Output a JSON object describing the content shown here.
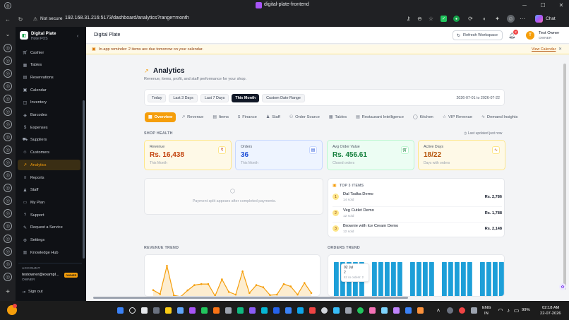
{
  "browser": {
    "tab_title": "digital-plate-frontend",
    "security": "Not secure",
    "url": "192.168.31.216:5173/dashboard/analytics?range=month",
    "chat_label": "Chat"
  },
  "sidebar": {
    "brand_name": "Digital Plate",
    "brand_sub": "Hotel POS",
    "items": [
      {
        "label": "Cashier",
        "icon": "cart-icon"
      },
      {
        "label": "Tables",
        "icon": "table-icon"
      },
      {
        "label": "Reservations",
        "icon": "clipboard-icon"
      },
      {
        "label": "Calendar",
        "icon": "calendar-icon"
      },
      {
        "label": "Inventory",
        "icon": "box-icon"
      },
      {
        "label": "Barcodes",
        "icon": "tag-icon"
      },
      {
        "label": "Expenses",
        "icon": "wallet-icon"
      },
      {
        "label": "Suppliers",
        "icon": "truck-icon"
      },
      {
        "label": "Customers",
        "icon": "user-icon"
      },
      {
        "label": "Analytics",
        "icon": "chart-icon"
      },
      {
        "label": "Reports",
        "icon": "report-icon"
      },
      {
        "label": "Staff",
        "icon": "users-icon"
      },
      {
        "label": "My Plan",
        "icon": "card-icon"
      },
      {
        "label": "Support",
        "icon": "help-icon"
      },
      {
        "label": "Request a Service",
        "icon": "request-icon"
      },
      {
        "label": "Settings",
        "icon": "gear-icon"
      },
      {
        "label": "Knowledge Hub",
        "icon": "book-icon"
      }
    ],
    "account_heading": "ACCOUNT",
    "account_email": "testowner@exampl...",
    "account_badge": "OWNER",
    "account_role": "OWNER",
    "sign_out": "Sign out"
  },
  "topbar": {
    "title": "Digital Plate",
    "refresh_label": "Refresh Workspace",
    "notif_count": "2",
    "avatar_letter": "T",
    "user_name": "Test Owner",
    "user_role": "OWNER"
  },
  "reminder": {
    "text": "In-app reminder: 2 items are due tomorrow on your calendar.",
    "link": "View Calendar"
  },
  "page": {
    "title": "Analytics",
    "subtitle": "Revenue, items, profit, and staff performance for your shop."
  },
  "ranges": {
    "chips": [
      "Today",
      "Last 3 Days",
      "Last 7 Days",
      "This Month",
      "Custom Date Range"
    ],
    "active": "This Month",
    "date_span": "2026-07-01 to 2026-07-22"
  },
  "tabs": [
    "Overview",
    "Revenue",
    "Items",
    "Finance",
    "Staff",
    "Order Source",
    "Tables",
    "Restaurant Intelligence",
    "Kitchen",
    "VIP Revenue",
    "Demand Insights"
  ],
  "health": {
    "heading": "SHOP HEALTH",
    "updated": "Last updated just now",
    "cards": [
      {
        "label": "Revenue",
        "value": "Rs. 16,438",
        "sub": "This Month",
        "icon": "rupee-icon",
        "accent": "#c2410c",
        "bg": "#fef9e7",
        "border": "#fde68a"
      },
      {
        "label": "Orders",
        "value": "36",
        "sub": "This Month",
        "icon": "receipt-icon",
        "accent": "#1d4ed8",
        "bg": "#eef4ff",
        "border": "#c7d7fe"
      },
      {
        "label": "Avg Order Value",
        "value": "Rs. 456.61",
        "sub": "Closed orders",
        "icon": "cart-icon",
        "accent": "#15803d",
        "bg": "#ecfdf3",
        "border": "#bbf7d0"
      },
      {
        "label": "Active Days",
        "value": "18/22",
        "sub": "Days with orders",
        "icon": "pulse-icon",
        "accent": "#b45309",
        "bg": "#fef9e7",
        "border": "#fde68a"
      }
    ]
  },
  "payment_split_msg": "Payment split appears after completed payments.",
  "top_items": {
    "heading": "TOP 3 ITEMS",
    "items": [
      {
        "rank": "1",
        "name": "Dal Tadka Demo",
        "sold": "14 sold",
        "amount": "Rs. 2,786"
      },
      {
        "rank": "2",
        "name": "Veg Cutlet Demo",
        "sold": "12 sold",
        "amount": "Rs. 1,788"
      },
      {
        "rank": "3",
        "name": "Brownie with Ice Cream Demo",
        "sold": "12 sold",
        "amount": "Rs. 2,148"
      }
    ]
  },
  "revenue_trend": {
    "heading": "REVENUE TREND"
  },
  "orders_trend": {
    "heading": "ORDERS TREND",
    "tooltip_date": "02 Jul",
    "tooltip_value": "2",
    "tooltip_detail": "52 co orders: 2"
  },
  "chart_data": [
    {
      "type": "area",
      "title": "REVENUE TREND",
      "values": [
        330,
        180,
        1250,
        130,
        80,
        320,
        520,
        560,
        560,
        110,
        740,
        260,
        160,
        1040,
        220,
        520,
        440,
        140,
        160,
        560,
        470,
        160,
        600,
        220
      ],
      "ylim": [
        0,
        1500
      ],
      "color": "#f59e0b"
    },
    {
      "type": "bar",
      "title": "ORDERS TREND",
      "values": [
        2,
        2,
        2,
        2,
        2,
        0,
        2,
        2,
        2,
        2,
        2,
        0,
        2,
        2,
        2,
        2,
        0,
        2,
        2,
        2,
        2,
        2,
        0,
        2,
        2,
        2,
        2
      ],
      "ylim": [
        0,
        2.3
      ],
      "color": "#1d9fd8"
    }
  ],
  "taskbar": {
    "lang_top": "ENG",
    "lang_bottom": "IN",
    "battery": "99%",
    "time": "02:18 AM",
    "date": "22-07-2026"
  }
}
